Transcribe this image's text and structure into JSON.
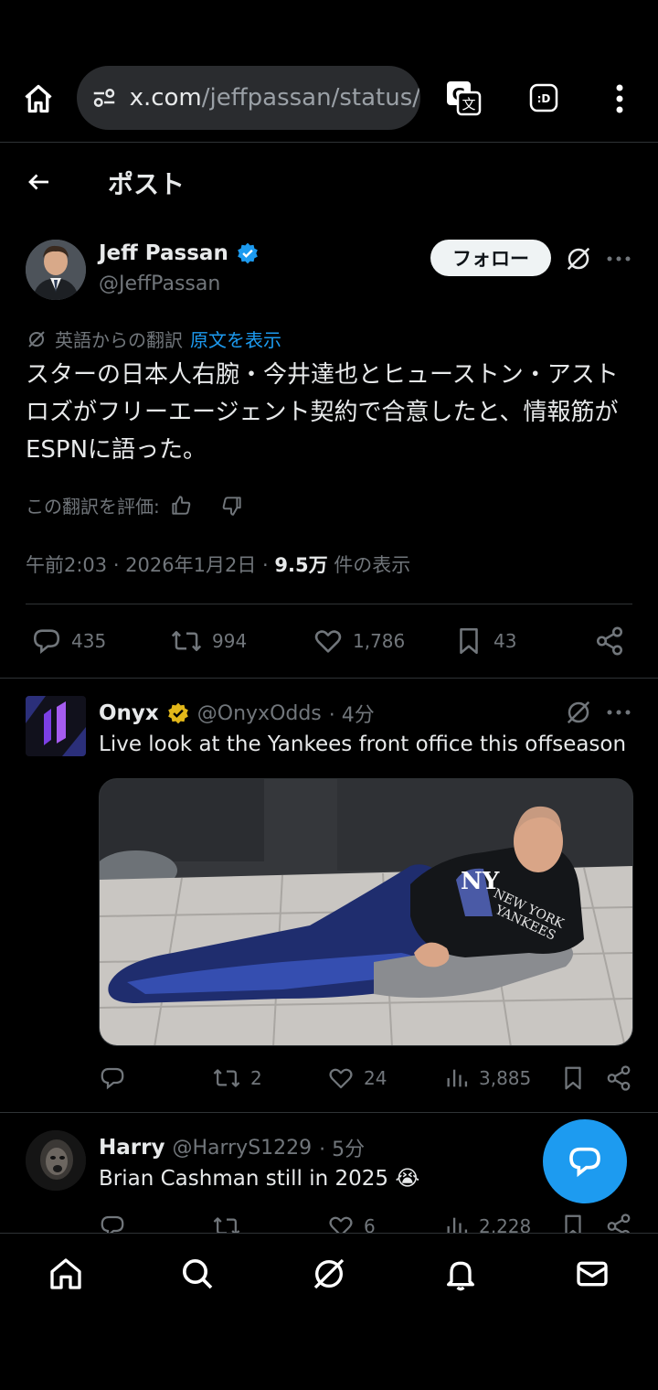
{
  "browser": {
    "url_host": "x.com",
    "url_path": "/jeffpassan/status/"
  },
  "header": {
    "title": "ポスト"
  },
  "tweet": {
    "author_name": "Jeff Passan",
    "author_handle": "@JeffPassan",
    "follow_label": "フォロー",
    "translated_from": "英語からの翻訳",
    "show_original": "原文を表示",
    "text": "スターの日本人右腕・今井達也とヒューストン・アストロズがフリーエージェント契約で合意したと、情報筋がESPNに語った。",
    "rate_label": "この翻訳を評価:",
    "time_date": "午前2:03 · 2026年1月2日 · ",
    "views": "9.5万",
    "views_suffix": " 件の表示",
    "replies": "435",
    "reposts": "994",
    "likes": "1,786",
    "bookmarks": "43"
  },
  "replies": [
    {
      "name": "Onyx",
      "handle": "@OnyxOdds",
      "time": "· 4分",
      "text": "Live look at the Yankees front office this offseason",
      "replies": "",
      "reposts": "2",
      "likes": "24",
      "views": "3,885"
    },
    {
      "name": "Harry",
      "handle": "@HarryS1229",
      "time": "· 5分",
      "text": "Brian Cashman still in 2025 😭",
      "replies": "",
      "reposts": "",
      "likes": "6",
      "views": "2,228"
    }
  ],
  "colors": {
    "accent": "#1d9bf0",
    "verified_blue": "#1d9bf0",
    "verified_gold": "#e2b719",
    "muted": "#71767b",
    "background": "#000000"
  },
  "icons": [
    "home-icon",
    "tune-icon",
    "translate-icon",
    "dex-icon",
    "more-vert-icon",
    "back-arrow-icon",
    "grok-icon",
    "more-icon",
    "reply-icon",
    "repost-icon",
    "like-icon",
    "bookmark-icon",
    "share-icon",
    "views-icon",
    "search-icon",
    "bell-icon",
    "mail-icon",
    "compose-reply-icon"
  ]
}
